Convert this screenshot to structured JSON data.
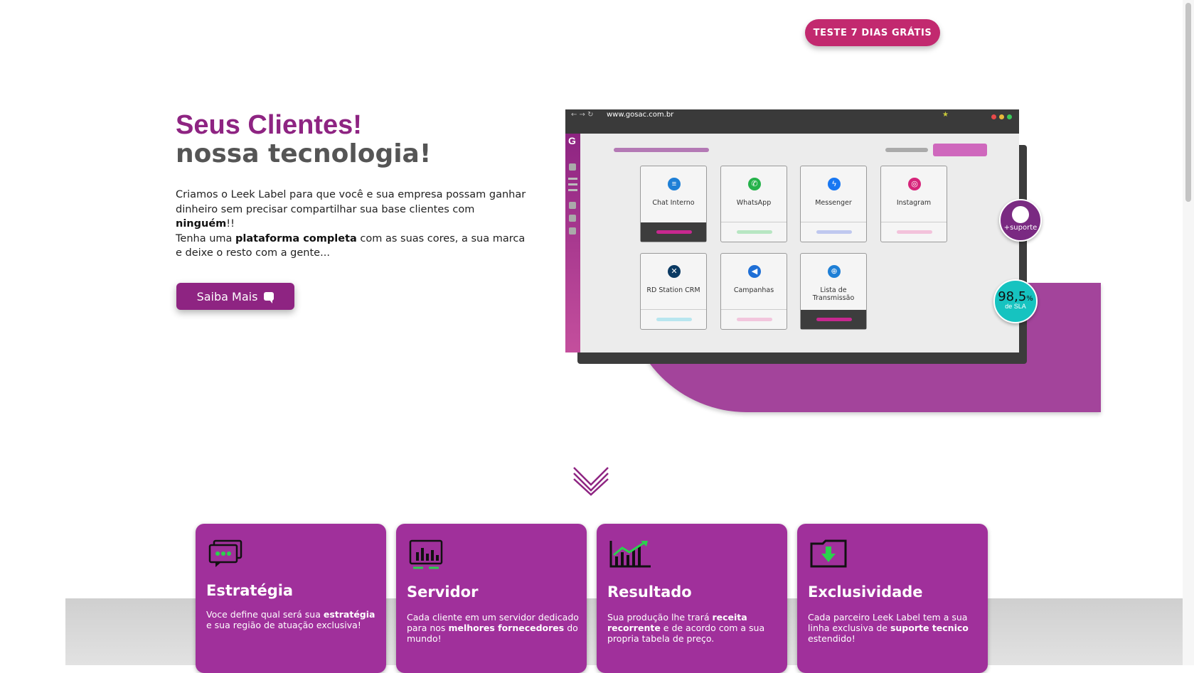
{
  "header": {
    "cta_label": "TESTE 7 DIAS GRÁTIS"
  },
  "hero": {
    "title_line1": "Seus Clientes!",
    "title_line2": "nossa tecnologia!",
    "p1": "Criamos o Leek Label para que você e sua empresa possam ganhar dinheiro sem precisar compartilhar sua base clientes com ",
    "p1_bold": "ninguém",
    "p1_end": "!!",
    "p2a": "Tenha uma ",
    "p2_bold": "plataforma completa",
    "p2b": " com as suas cores, a sua marca e deixe o resto com a gente...",
    "button_label": "Saiba Mais"
  },
  "mockup": {
    "url": "www.gosac.com.br",
    "cards": [
      {
        "label": "Chat Interno",
        "icon": "chat-bubbles-icon",
        "color": "#1e7fd6",
        "bar": "#c7288f",
        "dark": true
      },
      {
        "label": "WhatsApp",
        "icon": "whatsapp-icon",
        "color": "#25b24a",
        "bar": "#b7e6c2",
        "dark": false
      },
      {
        "label": "Messenger",
        "icon": "messenger-icon",
        "color": "#1877f2",
        "bar": "#bfc8ef",
        "dark": false
      },
      {
        "label": "Instagram",
        "icon": "instagram-icon",
        "color": "#d6247a",
        "bar": "#f3c2db",
        "dark": false
      },
      {
        "label": "RD Station CRM",
        "icon": "rd-station-icon",
        "color": "#0b3a63",
        "bar": "#b8e6ef",
        "dark": false
      },
      {
        "label": "Campanhas",
        "icon": "megaphone-icon",
        "color": "#1e6fd6",
        "bar": "#f2c6dd",
        "dark": false
      },
      {
        "label": "Lista de Transmissão",
        "icon": "globe-icon",
        "color": "#1e7fd6",
        "bar": "#c7288f",
        "dark": true
      }
    ],
    "support_label": "+suporte",
    "sla_value": "98,5",
    "sla_unit": "%",
    "sla_label": "de SLA"
  },
  "features": [
    {
      "title": "Estratégia",
      "icon": "speech-bubbles-icon",
      "parts": [
        [
          "Voce define qual será sua ",
          false
        ],
        [
          "estratégia",
          true
        ],
        [
          " e sua região de atuação  exclusiva!",
          false
        ]
      ]
    },
    {
      "title": "Servidor",
      "icon": "server-monitor-icon",
      "parts": [
        [
          "Cada cliente em um servidor dedicado para nos ",
          false
        ],
        [
          "melhores fornecedores",
          true
        ],
        [
          " do mundo!",
          false
        ]
      ]
    },
    {
      "title": "Resultado",
      "icon": "growth-chart-icon",
      "parts": [
        [
          "Sua produção lhe trará ",
          false
        ],
        [
          "receita recorrente",
          true
        ],
        [
          " e de acordo com a sua propria tabela de preço.",
          false
        ]
      ]
    },
    {
      "title": "Exclusividade",
      "icon": "download-folder-icon",
      "parts": [
        [
          "Cada parceiro Leek Label tem a sua linha exclusiva de ",
          false
        ],
        [
          "suporte tecnico",
          true
        ],
        [
          " estendido!",
          false
        ]
      ]
    }
  ],
  "colors": {
    "brand": "#8e2482",
    "cta": "#c2296f",
    "feature_bg": "#a0309b",
    "accent_green": "#2bd14d"
  }
}
